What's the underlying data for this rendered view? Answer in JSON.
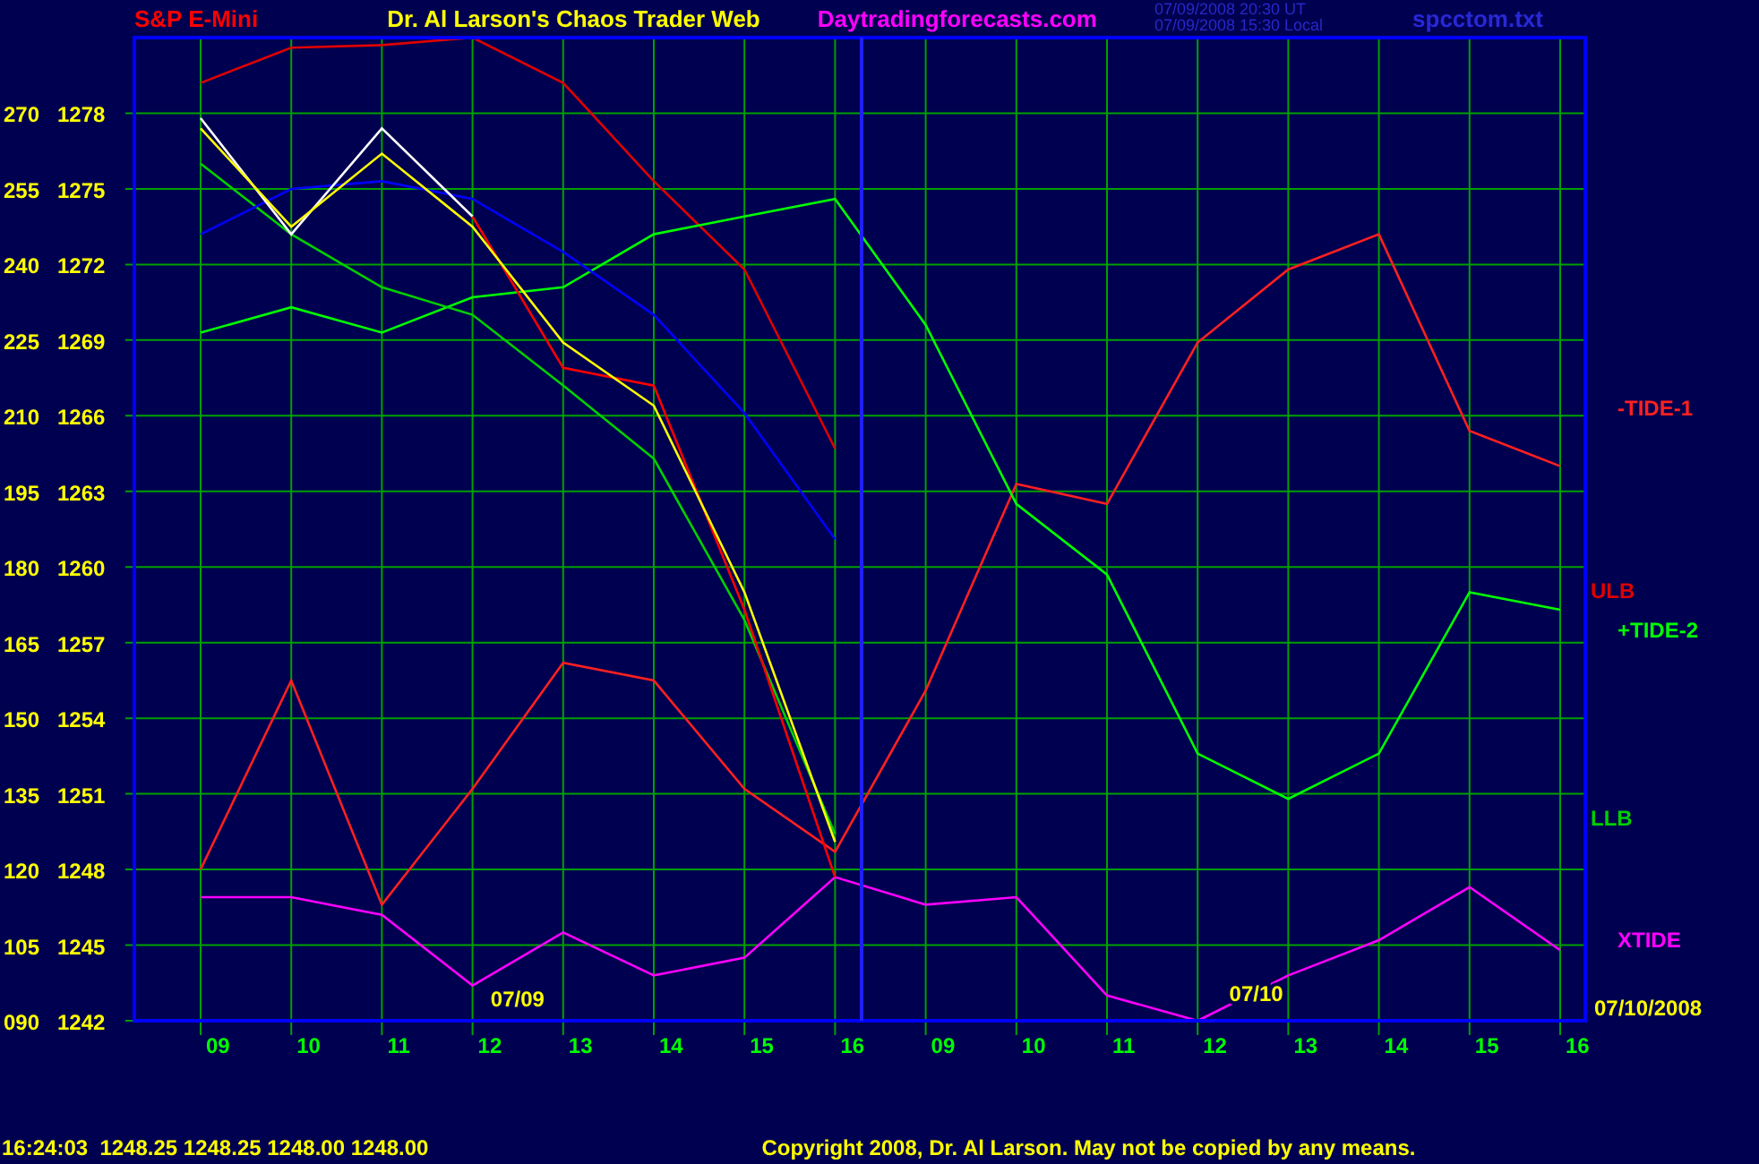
{
  "header": {
    "symbol": "S&P E-Mini",
    "title": "Dr. Al Larson's Chaos Trader Web",
    "site": "Daytradingforecasts.com",
    "timestamps": [
      "07/09/2008 20:30 UT",
      "07/09/2008 15:30 Local"
    ],
    "file": "spcctom.txt"
  },
  "chart": {
    "y_alt_labels": [
      "270",
      "255",
      "240",
      "225",
      "210",
      "195",
      "180",
      "165",
      "150",
      "135",
      "120",
      "105",
      "090"
    ],
    "chart_data": {
      "type": "line",
      "categories": [
        "09",
        "10",
        "11",
        "12",
        "13",
        "14",
        "15",
        "16",
        "09",
        "10",
        "11",
        "12",
        "13",
        "14",
        "15",
        "16"
      ],
      "ylim": [
        1242,
        1281
      ],
      "grid": true,
      "yticks": [
        1278,
        1275,
        1272,
        1269,
        1266,
        1263,
        1260,
        1257,
        1254,
        1251,
        1248,
        1245,
        1242
      ],
      "series": [
        {
          "name": "-TIDE-1",
          "color": "#ff2020",
          "values": [
            1248.0,
            1255.5,
            1246.6,
            1251.2,
            1256.2,
            1255.5,
            1251.2,
            1248.7,
            1255.1,
            1263.3,
            1262.5,
            1268.9,
            1271.8,
            1273.2,
            1265.4,
            1264.0
          ]
        },
        {
          "name": "ULB",
          "color": "#e00000",
          "values": [
            1279.2,
            1280.6,
            1280.7,
            1281.0,
            1279.2,
            1275.3,
            1271.8,
            1264.7,
            null,
            null,
            null,
            null,
            null,
            null,
            null,
            null
          ]
        },
        {
          "name": "+TIDE-2",
          "color": "#00ff00",
          "values": [
            1269.3,
            1270.3,
            1269.3,
            1270.7,
            1271.1,
            1273.2,
            1273.9,
            1274.6,
            1269.6,
            1262.5,
            1259.7,
            1252.6,
            1250.8,
            1252.6,
            1259.0,
            1258.3
          ]
        },
        {
          "name": "LLB",
          "color": "#00d000",
          "values": [
            1276.0,
            1273.2,
            1271.1,
            1270.0,
            1267.2,
            1264.3,
            1257.9,
            1249.4,
            null,
            null,
            null,
            null,
            null,
            null,
            null,
            null
          ]
        },
        {
          "name": "XTIDE",
          "color": "#ff00ff",
          "values": [
            1246.9,
            1246.9,
            1246.2,
            1243.4,
            1245.5,
            1243.8,
            1244.5,
            1247.7,
            1246.6,
            1246.9,
            1243.0,
            1242.0,
            1243.8,
            1245.2,
            1247.3,
            1244.8
          ]
        },
        {
          "color": "#0000ff",
          "values": [
            1273.2,
            1275.0,
            1275.3,
            1274.6,
            1272.5,
            1270.0,
            1266.1,
            1261.1,
            null,
            null,
            null,
            null,
            null,
            null,
            null,
            null
          ]
        },
        {
          "color": "#ffffff",
          "values": [
            1277.8,
            1273.2,
            1277.4,
            1273.9,
            null,
            null,
            null,
            null,
            null,
            null,
            null,
            null,
            null,
            null,
            null,
            null
          ]
        },
        {
          "color": "#ff0000",
          "values": [
            null,
            null,
            null,
            1273.9,
            1267.9,
            1267.2,
            1258.3,
            1247.7,
            null,
            null,
            null,
            null,
            null,
            null,
            null,
            null
          ]
        },
        {
          "color": "#ffff00",
          "values": [
            1277.4,
            1273.5,
            1276.4,
            1273.5,
            1268.9,
            1266.4,
            1259.0,
            1249.1,
            null,
            null,
            null,
            null,
            null,
            null,
            null,
            null
          ]
        }
      ],
      "annotations": [
        "07/09",
        "07/10"
      ]
    },
    "date_label": "07/10/2008"
  },
  "footer": {
    "quote": "16:24:03  1248.25 1248.25 1248.00 1248.00",
    "copyright": "Copyright 2008, Dr. Al Larson. May not be copied by any means."
  }
}
